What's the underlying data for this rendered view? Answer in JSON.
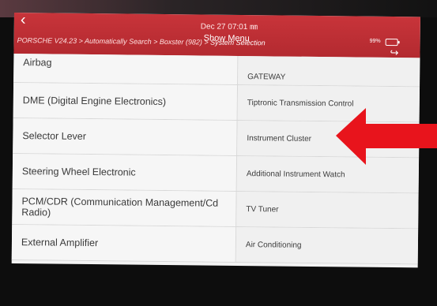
{
  "status": {
    "datetime": "Dec 27 07:01 ㎜",
    "battery": "99%"
  },
  "header": {
    "title": "Show Menu"
  },
  "breadcrumb": {
    "path": "PORSCHE V24.23 > Automatically Search > Boxster (982) >",
    "current": "System Selection"
  },
  "rows": [
    {
      "left": "Airbag",
      "right": "GATEWAY"
    },
    {
      "left": "DME (Digital Engine Electronics)",
      "right": "Tiptronic Transmission Control"
    },
    {
      "left": "Selector Lever",
      "right": "Instrument Cluster"
    },
    {
      "left": "Steering Wheel Electronic",
      "right": "Additional Instrument Watch"
    },
    {
      "left": "PCM/CDR (Communication Management/Cd Radio)",
      "right": "TV Tuner"
    },
    {
      "left": "External Amplifier",
      "right": "Air Conditioning"
    }
  ],
  "colors": {
    "header": "#b32a30",
    "arrow": "#e8141c"
  },
  "icons": [
    "back-icon",
    "battery-icon",
    "exit-icon",
    "red-arrow-icon"
  ]
}
